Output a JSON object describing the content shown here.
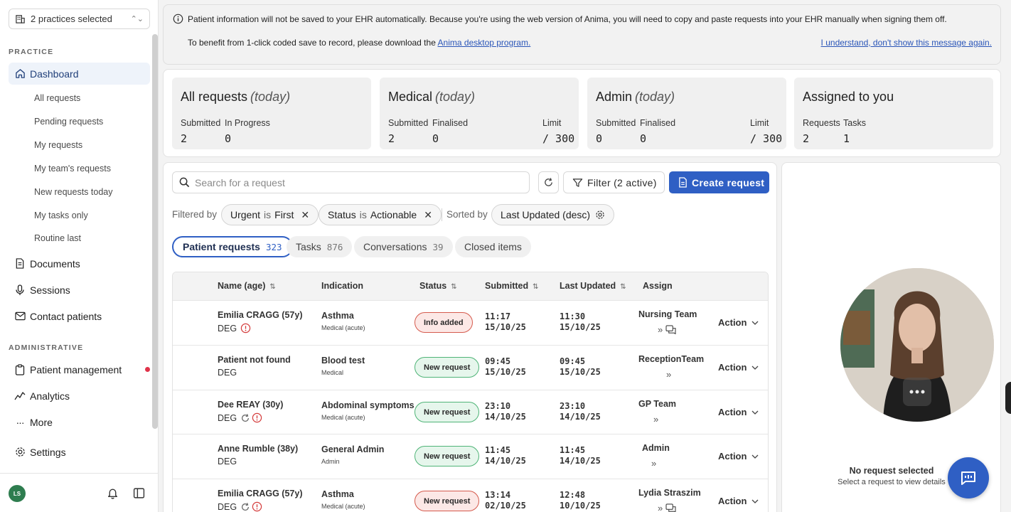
{
  "sidebar": {
    "practice_selector": "2 practices selected",
    "section_practice": "PRACTICE",
    "dashboard": "Dashboard",
    "sub_items": [
      "All requests",
      "Pending requests",
      "My requests",
      "My team's requests",
      "New requests today",
      "My tasks only",
      "Routine last"
    ],
    "documents": "Documents",
    "sessions": "Sessions",
    "contact_patients": "Contact patients",
    "section_admin": "ADMINISTRATIVE",
    "patient_management": "Patient management",
    "analytics": "Analytics",
    "more": "More",
    "settings": "Settings",
    "user_initials": "LS"
  },
  "notice": {
    "line1": "Patient information will not be saved to your EHR automatically. Because you're using the web version of Anima, you will need to copy and paste requests into your EHR manually when signing them off.",
    "line2_prefix": "To benefit from 1-click coded save to record, please download the",
    "line2_link": "Anima desktop program.",
    "dismiss": "I understand, don't show this message again."
  },
  "stats": {
    "all": {
      "title": "All requests",
      "qualifier": "(today)",
      "l1": "Submitted",
      "l2": "In Progress",
      "v1": "2",
      "v2": "0"
    },
    "medical": {
      "title": "Medical",
      "qualifier": "(today)",
      "l1": "Submitted",
      "l2": "Finalised",
      "l3": "Limit",
      "v1": "2",
      "v2": "0",
      "v3": "/ 300"
    },
    "admin": {
      "title": "Admin",
      "qualifier": "(today)",
      "l1": "Submitted",
      "l2": "Finalised",
      "l3": "Limit",
      "v1": "0",
      "v2": "0",
      "v3": "/ 300"
    },
    "assigned": {
      "title": "Assigned to you",
      "l1": "Requests",
      "l2": "Tasks",
      "v1": "2",
      "v2": "1"
    }
  },
  "toolbar": {
    "search_placeholder": "Search for a request",
    "filter_label": "Filter (2 active)",
    "create_label": "Create request"
  },
  "filters": {
    "filtered_by": "Filtered by",
    "chip1_key": "Urgent",
    "chip1_op": "is",
    "chip1_val": "First",
    "chip2_key": "Status",
    "chip2_op": "is",
    "chip2_val": "Actionable",
    "sorted_by": "Sorted by",
    "sort_val": "Last Updated (desc)"
  },
  "tabs": [
    {
      "label": "Patient requests",
      "count": "323"
    },
    {
      "label": "Tasks",
      "count": "876"
    },
    {
      "label": "Conversations",
      "count": "39"
    },
    {
      "label": "Closed items",
      "count": ""
    }
  ],
  "table": {
    "headers": {
      "name": "Name (age)",
      "indication": "Indication",
      "status": "Status",
      "submitted": "Submitted",
      "updated": "Last Updated",
      "assign": "Assign"
    },
    "rows": [
      {
        "name": "Emilia CRAGG (57y)",
        "deg": "DEG",
        "indication": "Asthma",
        "ind_sub": "Medical (acute)",
        "status": "Info added",
        "sub_t": "11:17",
        "sub_d": "15/10/25",
        "upd_t": "11:30",
        "upd_d": "15/10/25",
        "assign": "Nursing Team",
        "action": "Action"
      },
      {
        "name": "Patient not found",
        "deg": "DEG",
        "indication": "Blood test",
        "ind_sub": "Medical",
        "status": "New request",
        "sub_t": "09:45",
        "sub_d": "15/10/25",
        "upd_t": "09:45",
        "upd_d": "15/10/25",
        "assign": "ReceptionTeam",
        "action": "Action"
      },
      {
        "name": "Dee REAY (30y)",
        "deg": "DEG",
        "indication": "Abdominal symptoms",
        "ind_sub": "Medical (acute)",
        "status": "New request",
        "sub_t": "23:10",
        "sub_d": "14/10/25",
        "upd_t": "23:10",
        "upd_d": "14/10/25",
        "assign": "GP Team",
        "action": "Action"
      },
      {
        "name": "Anne Rumble (38y)",
        "deg": "DEG",
        "indication": "General Admin",
        "ind_sub": "Admin",
        "status": "New request",
        "sub_t": "11:45",
        "sub_d": "14/10/25",
        "upd_t": "11:45",
        "upd_d": "14/10/25",
        "assign": "Admin",
        "action": "Action"
      },
      {
        "name": "Emilia CRAGG (57y)",
        "deg": "DEG",
        "indication": "Asthma",
        "ind_sub": "Medical (acute)",
        "status": "New request",
        "sub_t": "13:14",
        "sub_d": "02/10/25",
        "upd_t": "12:48",
        "upd_d": "10/10/25",
        "assign": "Lydia Straszim",
        "action": "Action"
      }
    ]
  },
  "detail": {
    "title": "No request selected",
    "subtitle": "Select a request to view details"
  },
  "colors": {
    "accent": "#2f5fc4",
    "info_badge": "#d55b4e",
    "new_badge": "#4fb477",
    "alert_dot": "#e0334a"
  }
}
